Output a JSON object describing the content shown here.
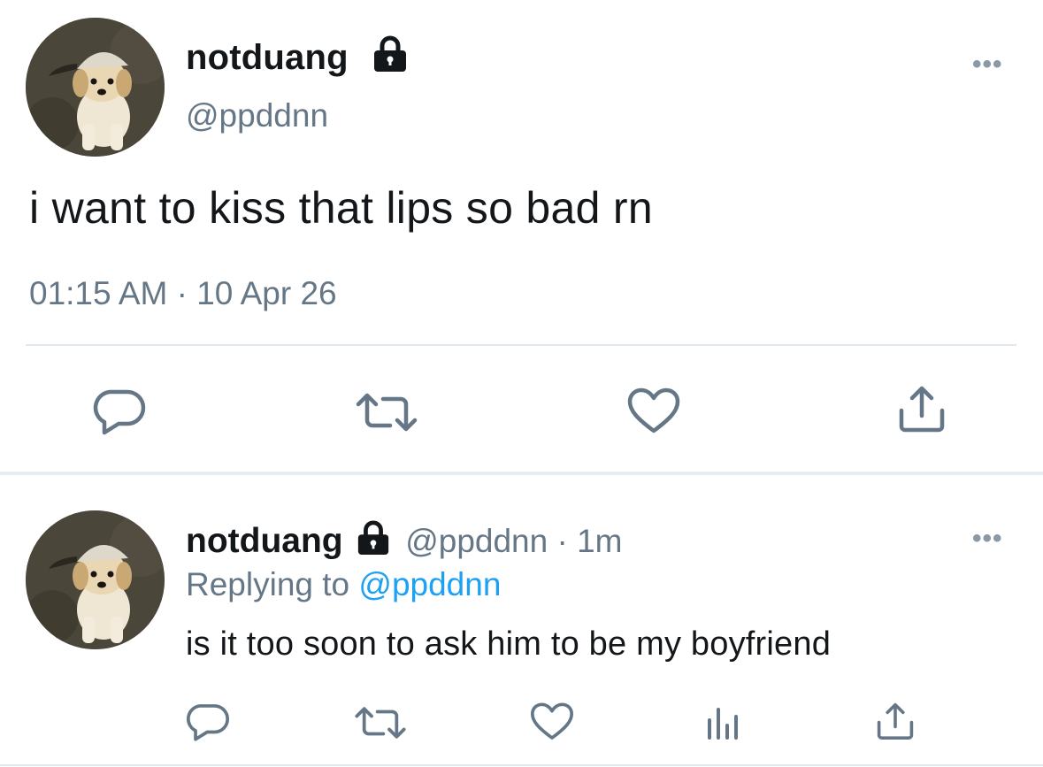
{
  "main_tweet": {
    "avatar_icon": "dog-avatar-icon",
    "display_name": "notduang",
    "protected_icon": "lock-icon",
    "handle": "@ppddnn",
    "more_label": "•••",
    "text": "i want to kiss that lips so bad rn",
    "timestamp": "01:15 AM · 10 Apr 26",
    "actions": [
      "reply-icon",
      "retweet-icon",
      "like-icon",
      "share-icon"
    ]
  },
  "reply_tweet": {
    "avatar_icon": "dog-avatar-icon",
    "display_name": "notduang",
    "protected_icon": "lock-icon",
    "handle": "@ppddnn",
    "separator": " · ",
    "time_ago": "1m",
    "more_label": "•••",
    "replying_prefix": "Replying to ",
    "replying_to": "@ppddnn",
    "text": "is it too soon to ask him to be my boyfriend",
    "actions": [
      "reply-icon",
      "retweet-icon",
      "like-icon",
      "analytics-icon",
      "share-icon"
    ]
  },
  "colors": {
    "text_primary": "#14171a",
    "text_secondary": "#657786",
    "icon_gray": "#657786",
    "link_blue": "#1da1f2",
    "divider": "#e1e8ed"
  }
}
